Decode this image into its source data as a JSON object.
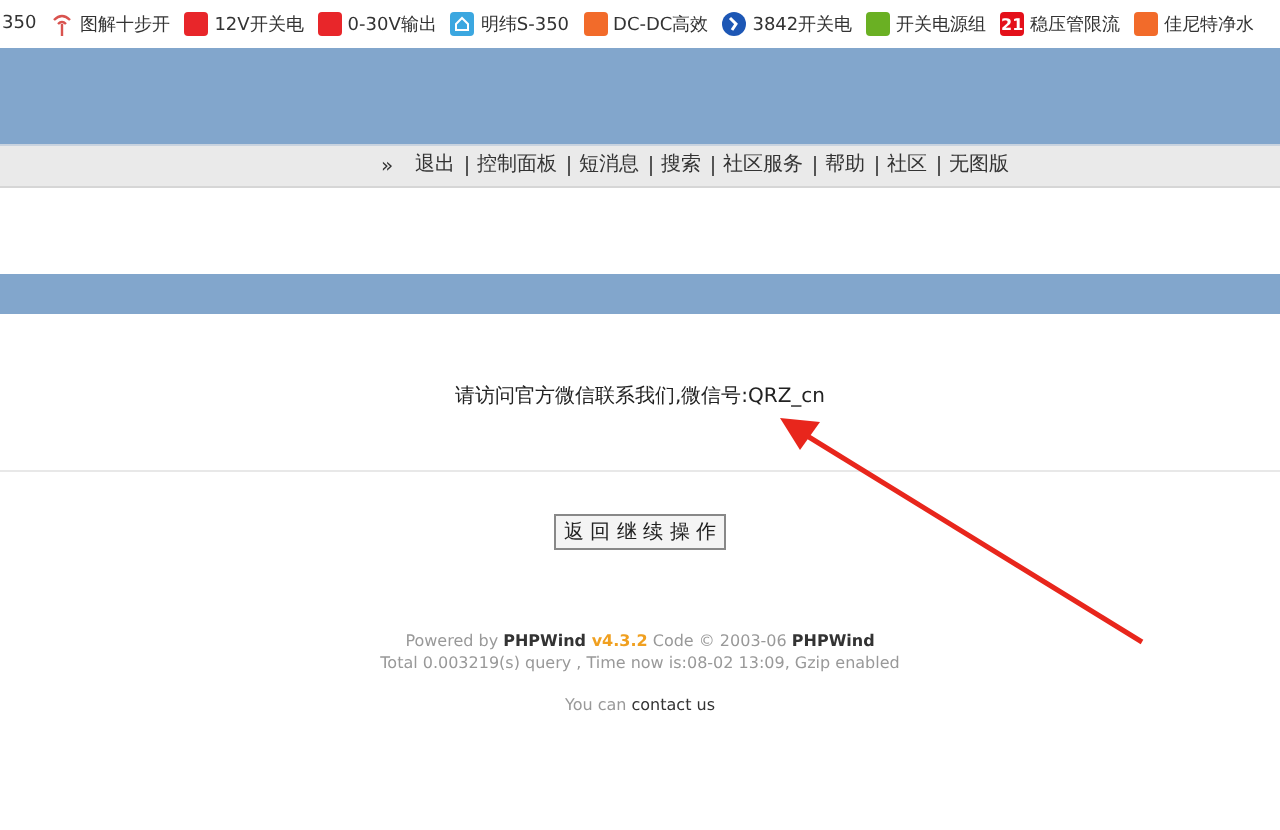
{
  "bookmarks": [
    {
      "label": "350",
      "kind": "none"
    },
    {
      "label": "图解十步开",
      "kind": "antenna",
      "color": "#d9534f"
    },
    {
      "label": "12V开关电",
      "kind": "square",
      "color": "#e8262a"
    },
    {
      "label": "0-30V输出",
      "kind": "square",
      "color": "#e8262a"
    },
    {
      "label": "明纬S-350",
      "kind": "house",
      "color": "#3ba7e0"
    },
    {
      "label": "DC-DC高效",
      "kind": "square",
      "color": "#f26b2a"
    },
    {
      "label": "3842开关电",
      "kind": "circle",
      "color": "#1d57b5"
    },
    {
      "label": "开关电源组",
      "kind": "square",
      "color": "#6ab023"
    },
    {
      "label": "稳压管限流",
      "kind": "text",
      "color": "#e4101a",
      "icon_text": "21"
    },
    {
      "label": "佳尼特净水",
      "kind": "square",
      "color": "#f26b2a"
    }
  ],
  "nav": {
    "marker": "»",
    "items": [
      "退出",
      "控制面板",
      "短消息",
      "搜索",
      "社区服务",
      "帮助",
      "社区",
      "无图版"
    ]
  },
  "message": "请访问官方微信联系我们,微信号:QRZ_cn",
  "button": "返 回 继 续 操 作",
  "footer": {
    "line1": [
      {
        "text": "Powered by ",
        "kind": "plain"
      },
      {
        "text": "PHPWind",
        "kind": "bold"
      },
      {
        "text": " v4.3.2",
        "kind": "version"
      },
      {
        "text": " Code © 2003-06 ",
        "kind": "plain"
      },
      {
        "text": "PHPWind",
        "kind": "bold"
      }
    ],
    "line2": "Total 0.003219(s) query , Time now is:08-02 13:09, Gzip enabled",
    "contact_prefix": "You can",
    "contact_link": "contact us"
  }
}
